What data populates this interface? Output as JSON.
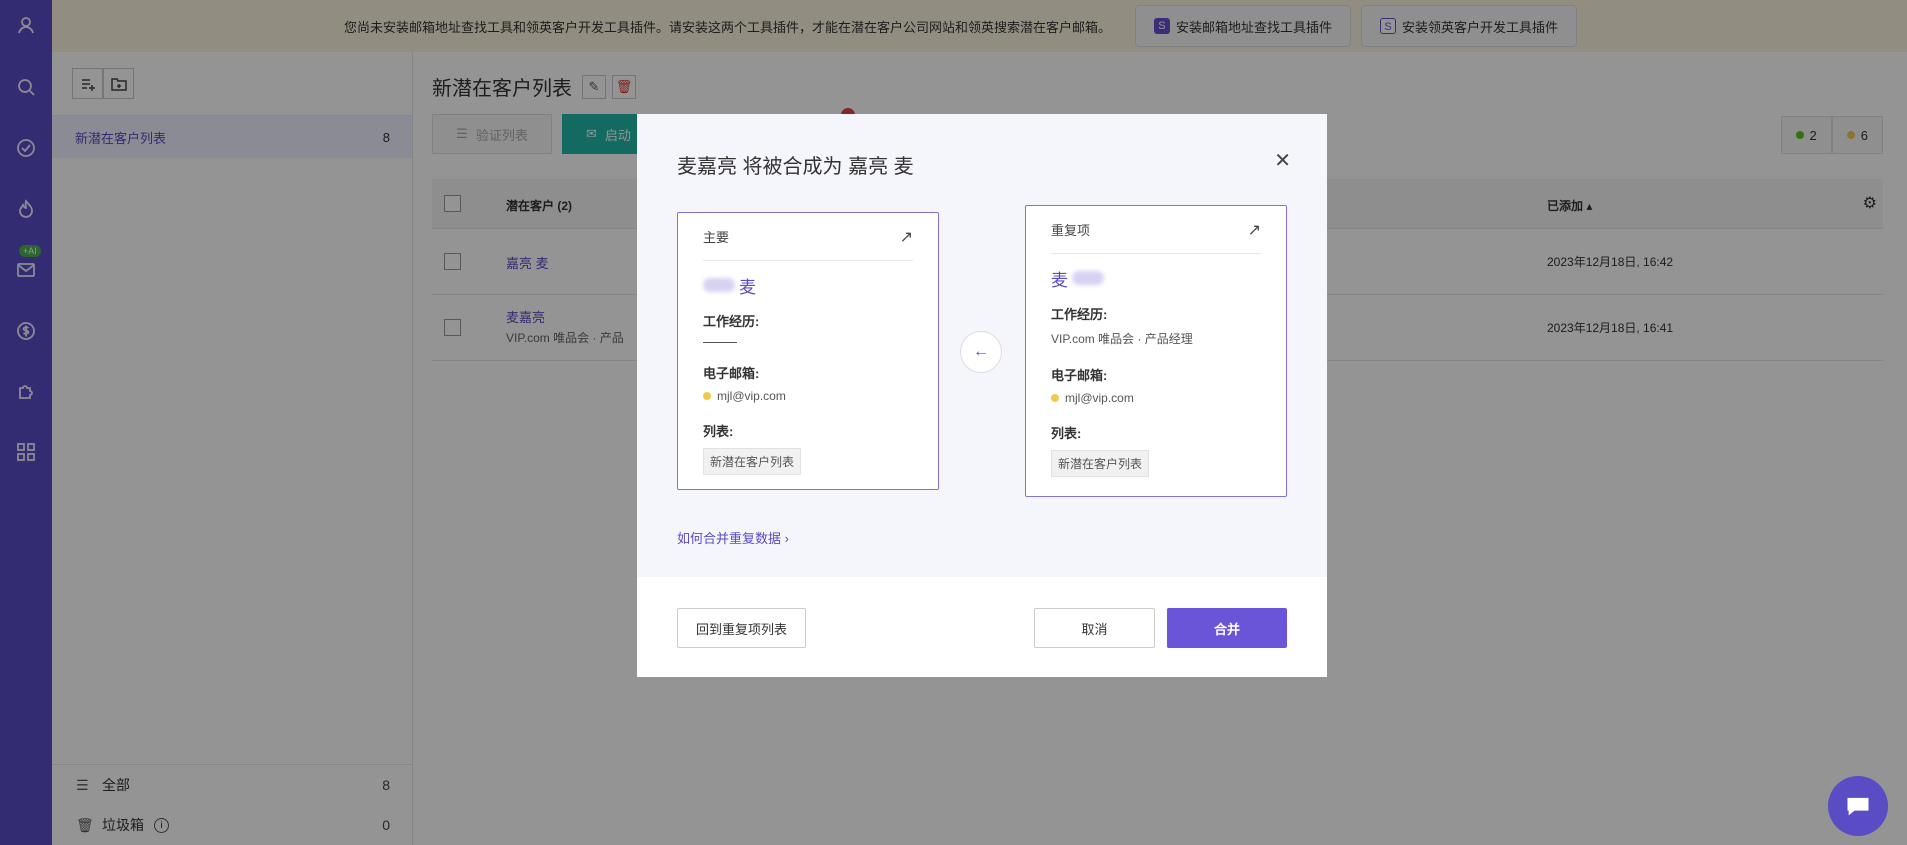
{
  "banner": {
    "message": "您尚未安装邮箱地址查找工具和领英客户开发工具插件。请安装这两个工具插件，才能在潜在客户公司网站和领英搜索潜在客户邮箱。",
    "btn_email_finder": "安装邮箱地址查找工具插件",
    "btn_linkedin": "安装领英客户开发工具插件",
    "badge_letter": "S"
  },
  "rail": {
    "ai_badge": "+AI"
  },
  "sidebar": {
    "list_name": "新潜在客户列表",
    "list_count": "8",
    "all_label": "全部",
    "all_count": "8",
    "trash_label": "垃圾箱",
    "trash_count": "0"
  },
  "main": {
    "title": "新潜在客户列表",
    "verify_btn": "验证列表",
    "start_btn": "启动",
    "stat_green": "2",
    "stat_yellow": "6",
    "col_prospect": "潜在客户 (2)",
    "col_added": "已添加",
    "rows": [
      {
        "name": "嘉亮 麦",
        "sub": "",
        "added": "2023年12月18日, 16:42"
      },
      {
        "name": "麦嘉亮",
        "sub": "VIP.com 唯品会 · 产品",
        "added": "2023年12月18日, 16:41"
      }
    ]
  },
  "modal": {
    "title": "麦嘉亮 将被合成为 嘉亮 麦",
    "primary": {
      "header": "主要",
      "name": "麦",
      "work_label": "工作经历:",
      "email_label": "电子邮箱:",
      "email": "mjl@vip.com",
      "list_label": "列表:",
      "list_tag": "新潜在客户列表"
    },
    "duplicate": {
      "header": "重复项",
      "name": "麦",
      "work_label": "工作经历:",
      "work_value": "VIP.com 唯品会 · 产品经理",
      "email_label": "电子邮箱:",
      "email": "mjl@vip.com",
      "list_label": "列表:",
      "list_tag": "新潜在客户列表"
    },
    "howto_link": "如何合并重复数据 ›",
    "back_btn": "回到重复项列表",
    "cancel_btn": "取消",
    "merge_btn": "合并"
  },
  "colors": {
    "brand": "#5a4cc4",
    "teal": "#1fb7a6",
    "merge": "#6a55d8"
  }
}
